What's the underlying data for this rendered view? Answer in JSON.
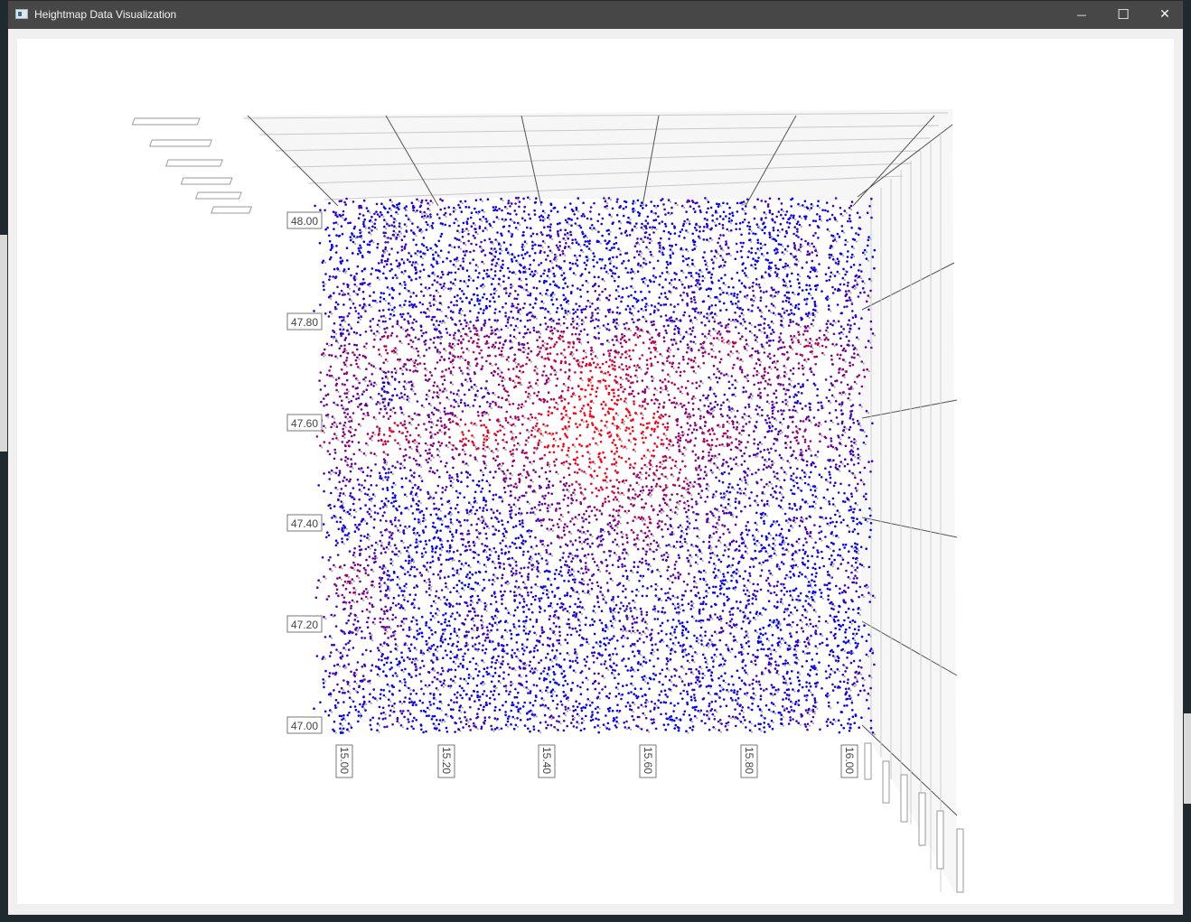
{
  "window": {
    "title": "Heightmap Data Visualization",
    "controls": {
      "minimize": "—",
      "maximize": "☐",
      "close": "✕"
    }
  },
  "chart_data": {
    "type": "scatter",
    "projection": "3d",
    "description_axes": {
      "x_ticks": [
        "15.00",
        "15.20",
        "15.40",
        "15.60",
        "15.80",
        "16.00"
      ],
      "y_ticks": [
        "48.00",
        "47.80",
        "47.60",
        "47.40",
        "47.20",
        "47.00"
      ],
      "x_range": [
        15.0,
        16.0
      ],
      "y_range": [
        47.0,
        48.0
      ]
    },
    "color_scale": {
      "low": "#0000ff",
      "high": "#ff0000"
    },
    "grid": true,
    "title": "",
    "xlabel": "",
    "ylabel": "",
    "zlabel": ""
  }
}
